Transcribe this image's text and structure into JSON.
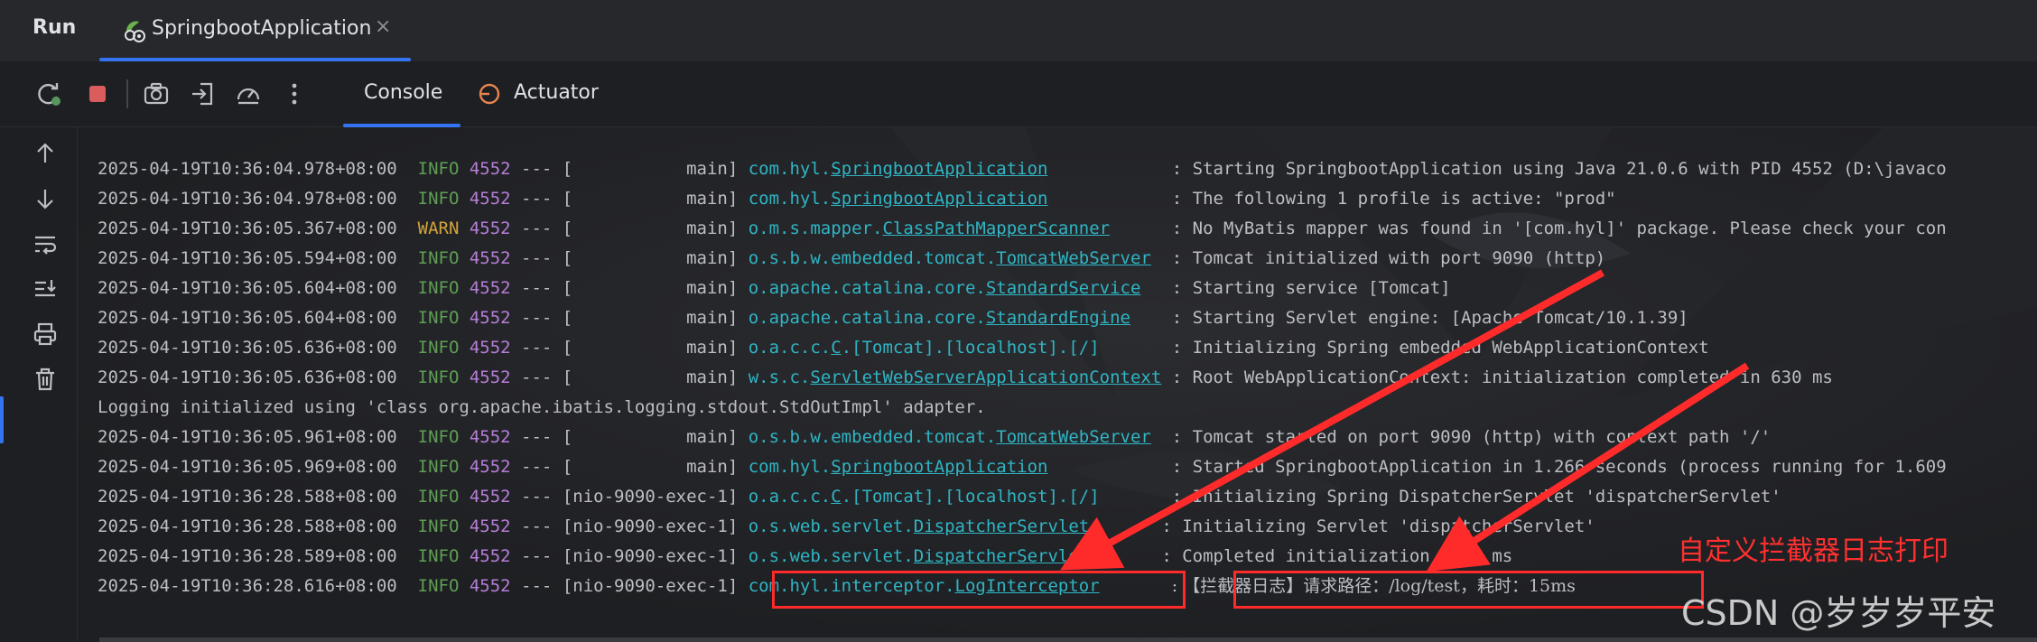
{
  "header": {
    "run_label": "Run",
    "tab_label": "SpringbootApplication",
    "close_glyph": "×"
  },
  "toolbar": {
    "icons": [
      "rerun-icon",
      "stop-icon",
      "camera-icon",
      "login-icon",
      "dashboard-icon",
      "more-icon"
    ],
    "tabs": [
      {
        "label": "Console",
        "active": true
      },
      {
        "label": "Actuator",
        "active": false
      }
    ]
  },
  "sidebar": {
    "icons": [
      "arrow-up-icon",
      "arrow-down-icon",
      "soft-wrap-icon",
      "scroll-to-end-icon",
      "print-icon",
      "trash-icon"
    ]
  },
  "console": {
    "lines": [
      {
        "ts": "2025-04-19T10:36:04.978+08:00",
        "level": "INFO",
        "pid": "4552",
        "thread": "           main",
        "logger_pre": "com.hyl.",
        "logger_u": "SpringbootApplication",
        "logger_post": "",
        "pad": "            ",
        "message": ": Starting SpringbootApplication using Java 21.0.6 with PID 4552 (D:\\javaco"
      },
      {
        "ts": "2025-04-19T10:36:04.978+08:00",
        "level": "INFO",
        "pid": "4552",
        "thread": "           main",
        "logger_pre": "com.hyl.",
        "logger_u": "SpringbootApplication",
        "logger_post": "",
        "pad": "            ",
        "message": ": The following 1 profile is active: \"prod\""
      },
      {
        "ts": "2025-04-19T10:36:05.367+08:00",
        "level": "WARN",
        "pid": "4552",
        "thread": "           main",
        "logger_pre": "o.m.s.mapper.",
        "logger_u": "ClassPathMapperScanner",
        "logger_post": "",
        "pad": "      ",
        "message": ": No MyBatis mapper was found in '[com.hyl]' package. Please check your con"
      },
      {
        "ts": "2025-04-19T10:36:05.594+08:00",
        "level": "INFO",
        "pid": "4552",
        "thread": "           main",
        "logger_pre": "o.s.b.w.embedded.tomcat.",
        "logger_u": "TomcatWebServer",
        "logger_post": "",
        "pad": "  ",
        "message": ": Tomcat initialized with port 9090 (http)"
      },
      {
        "ts": "2025-04-19T10:36:05.604+08:00",
        "level": "INFO",
        "pid": "4552",
        "thread": "           main",
        "logger_pre": "o.apache.catalina.core.",
        "logger_u": "StandardService",
        "logger_post": "",
        "pad": "   ",
        "message": ": Starting service [Tomcat]"
      },
      {
        "ts": "2025-04-19T10:36:05.604+08:00",
        "level": "INFO",
        "pid": "4552",
        "thread": "           main",
        "logger_pre": "o.apache.catalina.core.",
        "logger_u": "StandardEngine",
        "logger_post": "",
        "pad": "    ",
        "message": ": Starting Servlet engine: [Apache Tomcat/10.1.39]"
      },
      {
        "ts": "2025-04-19T10:36:05.636+08:00",
        "level": "INFO",
        "pid": "4552",
        "thread": "           main",
        "logger_pre": "o.a.c.c.",
        "logger_u": "C",
        "logger_post": ".[Tomcat].[localhost].[/]",
        "pad": "       ",
        "message": ": Initializing Spring embedded WebApplicationContext"
      },
      {
        "ts": "2025-04-19T10:36:05.636+08:00",
        "level": "INFO",
        "pid": "4552",
        "thread": "           main",
        "logger_pre": "w.s.c.",
        "logger_u": "ServletWebServerApplicationContext",
        "logger_post": "",
        "pad": " ",
        "message": ": Root WebApplicationContext: initialization completed in 630 ms"
      },
      {
        "raw": "Logging initialized using 'class org.apache.ibatis.logging.stdout.StdOutImpl' adapter."
      },
      {
        "ts": "2025-04-19T10:36:05.961+08:00",
        "level": "INFO",
        "pid": "4552",
        "thread": "           main",
        "logger_pre": "o.s.b.w.embedded.tomcat.",
        "logger_u": "TomcatWebServer",
        "logger_post": "",
        "pad": "  ",
        "message": ": Tomcat started on port 9090 (http) with context path '/'"
      },
      {
        "ts": "2025-04-19T10:36:05.969+08:00",
        "level": "INFO",
        "pid": "4552",
        "thread": "           main",
        "logger_pre": "com.hyl.",
        "logger_u": "SpringbootApplication",
        "logger_post": "",
        "pad": "            ",
        "message": ": Started SpringbootApplication in 1.266 seconds (process running for 1.609"
      },
      {
        "ts": "2025-04-19T10:36:28.588+08:00",
        "level": "INFO",
        "pid": "4552",
        "thread": "[nio-9090-exec-1",
        "logger_pre": "o.a.c.c.",
        "logger_u": "C",
        "logger_post": ".[Tomcat].[localhost].[/]",
        "pad": "       ",
        "message": ": Initializing Spring DispatcherServlet 'dispatcherServlet'",
        "bracket_inline": true
      },
      {
        "ts": "2025-04-19T10:36:28.588+08:00",
        "level": "INFO",
        "pid": "4552",
        "thread": "[nio-9090-exec-1",
        "logger_pre": "o.s.web.servlet.",
        "logger_u": "DispatcherServlet",
        "logger_post": "",
        "pad": "       ",
        "message": ": Initializing Servlet 'dispatcherServlet'",
        "bracket_inline": true
      },
      {
        "ts": "2025-04-19T10:36:28.589+08:00",
        "level": "INFO",
        "pid": "4552",
        "thread": "[nio-9090-exec-1",
        "logger_pre": "o.s.web.servlet.",
        "logger_u": "DispatcherServlet",
        "logger_post": "",
        "pad": "       ",
        "message": ": Completed initialization in 1 ms",
        "bracket_inline": true
      },
      {
        "ts": "2025-04-19T10:36:28.616+08:00",
        "level": "INFO",
        "pid": "4552",
        "thread": "[nio-9090-exec-1",
        "logger_pre": "com.hyl.interceptor.",
        "logger_u": "LogInterceptor",
        "logger_post": "",
        "pad": "       ",
        "message": ": 【拦截器日志】请求路径：/log/test，耗时：15ms",
        "bracket_inline": true,
        "cjk": true
      }
    ]
  },
  "annotation": {
    "text": "自定义拦截器日志打印",
    "color": "#ff3030"
  },
  "watermark": {
    "text": "CSDN @岁岁岁平安"
  },
  "colors": {
    "accent": "#3574f0",
    "info": "#5f9e54",
    "warn": "#d3a33c",
    "pid": "#b77ed8",
    "logger": "#2fb5c4",
    "highlight": "#ff2b2b"
  }
}
